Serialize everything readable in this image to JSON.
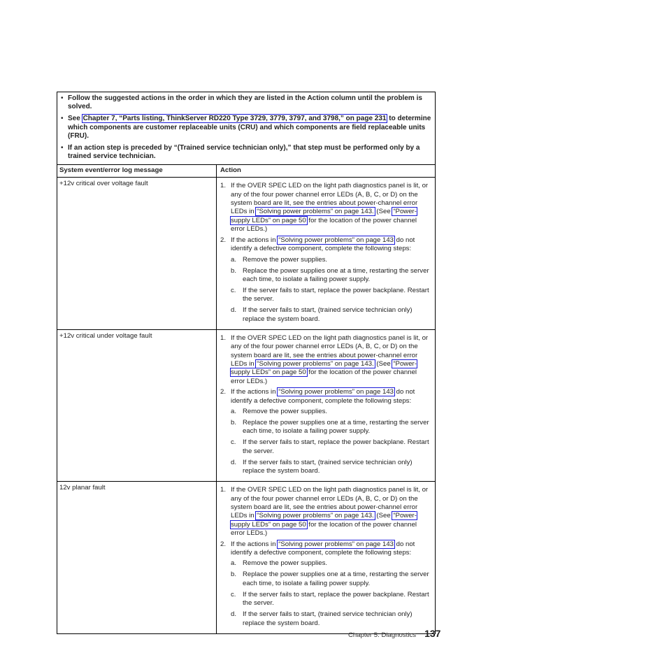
{
  "notes": [
    {
      "before": "Follow the suggested actions in the order in which they are listed in the Action column until the problem is solved.",
      "link": "",
      "after": ""
    },
    {
      "before": "See ",
      "link": "Chapter 7, “Parts listing, ThinkServer RD220 Type 3729, 3779, 3797, and 3798,” on page 231",
      "after": " to determine which components are customer replaceable units (CRU) and which components are field replaceable units (FRU)."
    },
    {
      "before": "If an action step is preceded by “(Trained service technician only),” that step must be performed only by a trained service technician.",
      "link": "",
      "after": ""
    }
  ],
  "table": {
    "headers": {
      "message": "System event/error log message",
      "action": "Action"
    },
    "rows": [
      {
        "message": "+12v critical over voltage fault",
        "step1": {
          "num": "1.",
          "text_a": "If the OVER SPEC LED on the light path diagnostics panel is lit, or any of the four power channel error LEDs (A, B, C, or D) on the system board are lit, see the entries about power-channel error LEDs in ",
          "link_a": "“Solving power problems” on page 143.",
          "text_b": " (See ",
          "link_b": "“Power-supply LEDs” on page 50",
          "text_c": " for the location of the power channel error LEDs.)"
        },
        "step2": {
          "num": "2.",
          "text_a": "If the actions in ",
          "link_a": "“Solving power problems” on page 143",
          "text_b": " do not identify a defective component, complete the following steps:"
        },
        "substeps": [
          {
            "num": "a.",
            "text": "Remove the power supplies."
          },
          {
            "num": "b.",
            "text": " Replace the power supplies one at a time, restarting the server each time, to isolate a failing power supply."
          },
          {
            "num": "c.",
            "text": "If the server fails to start, replace the power backplane. Restart the server."
          },
          {
            "num": "d.",
            "text": "If the server fails to start, (trained service technician only) replace the system board."
          }
        ]
      },
      {
        "message": "+12v critical under voltage fault",
        "step1": {
          "num": "1.",
          "text_a": "If the OVER SPEC LED on the light path diagnostics panel is lit, or any of the four power channel error LEDs (A, B, C, or D) on the system board are lit, see the entries about power-channel error LEDs in ",
          "link_a": "“Solving power problems” on page 143.",
          "text_b": " (See ",
          "link_b": "“Power-supply LEDs” on page 50",
          "text_c": " for the location of the power channel error LEDs.)"
        },
        "step2": {
          "num": "2.",
          "text_a": "If the actions in ",
          "link_a": "“Solving power problems” on page 143",
          "text_b": " do not identify a defective component, complete the following steps:"
        },
        "substeps": [
          {
            "num": "a.",
            "text": "Remove the power supplies."
          },
          {
            "num": "b.",
            "text": "Replace the power supplies one at a time, restarting the server each time, to isolate a failing power supply."
          },
          {
            "num": "c.",
            "text": "If the server fails to start, replace the power backplane. Restart the server."
          },
          {
            "num": "d.",
            "text": "If the server fails to start, (trained service technician only) replace the system board."
          }
        ]
      },
      {
        "message": "12v planar fault",
        "step1": {
          "num": "1.",
          "text_a": "If the OVER SPEC LED on the light path diagnostics panel is lit, or any of the four power channel error LEDs (A, B, C, or D) on the system board are lit, see the entries about power-channel error LEDs in ",
          "link_a": "“Solving power problems” on page 143.",
          "text_b": " (See ",
          "link_b": "“Power-supply LEDs” on page 50",
          "text_c": " for the location of the power channel error LEDs.)"
        },
        "step2": {
          "num": "2.",
          "text_a": "If the actions in ",
          "link_a": "“Solving power problems” on page 143",
          "text_b": " do not identify a defective component, complete the following steps:"
        },
        "substeps": [
          {
            "num": "a.",
            "text": "Remove the power supplies."
          },
          {
            "num": "b.",
            "text": "Replace the power supplies one at a time, restarting the server each time, to isolate a failing power supply."
          },
          {
            "num": "c.",
            "text": "If the server fails to start, replace the power backplane. Restart the server."
          },
          {
            "num": "d.",
            "text": "If the server fails to start, (trained service technician only) replace the system board."
          }
        ]
      }
    ]
  },
  "footer": {
    "chapter": "Chapter 5. Diagnostics",
    "page_number": "137"
  },
  "colors": {
    "link_box": "#1a1ad8",
    "text": "#222222",
    "rule": "#000000"
  }
}
